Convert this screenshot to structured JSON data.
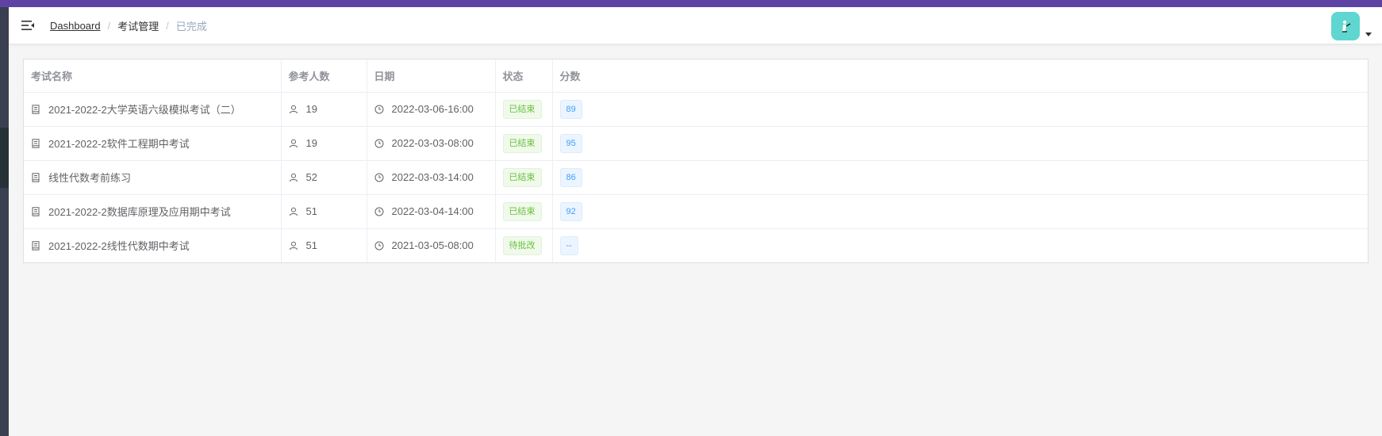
{
  "breadcrumb": {
    "home": "Dashboard",
    "parent": "考试管理",
    "current": "已完成"
  },
  "table": {
    "headers": {
      "name": "考试名称",
      "participants": "参考人数",
      "date": "日期",
      "status": "状态",
      "score": "分数"
    },
    "rows": [
      {
        "name": "2021-2022-2大学英语六级模拟考试（二）",
        "participants": "19",
        "date": "2022-03-06-16:00",
        "status": "已结束",
        "score": "89"
      },
      {
        "name": "2021-2022-2软件工程期中考试",
        "participants": "19",
        "date": "2022-03-03-08:00",
        "status": "已结束",
        "score": "95"
      },
      {
        "name": "线性代数考前练习",
        "participants": "52",
        "date": "2022-03-03-14:00",
        "status": "已结束",
        "score": "86"
      },
      {
        "name": "2021-2022-2数据库原理及应用期中考试",
        "participants": "51",
        "date": "2022-03-04-14:00",
        "status": "已结束",
        "score": "92"
      },
      {
        "name": "2021-2022-2线性代数期中考试",
        "participants": "51",
        "date": "2021-03-05-08:00",
        "status": "待批改",
        "score": "--"
      }
    ]
  },
  "icons": {
    "name": "document-icon",
    "participants": "user-icon",
    "date": "clock-icon"
  },
  "colors": {
    "accent": "#5e43a5",
    "avatar": "#5fd6d0",
    "status_tag": "#67c23a",
    "score_tag": "#409eff"
  }
}
